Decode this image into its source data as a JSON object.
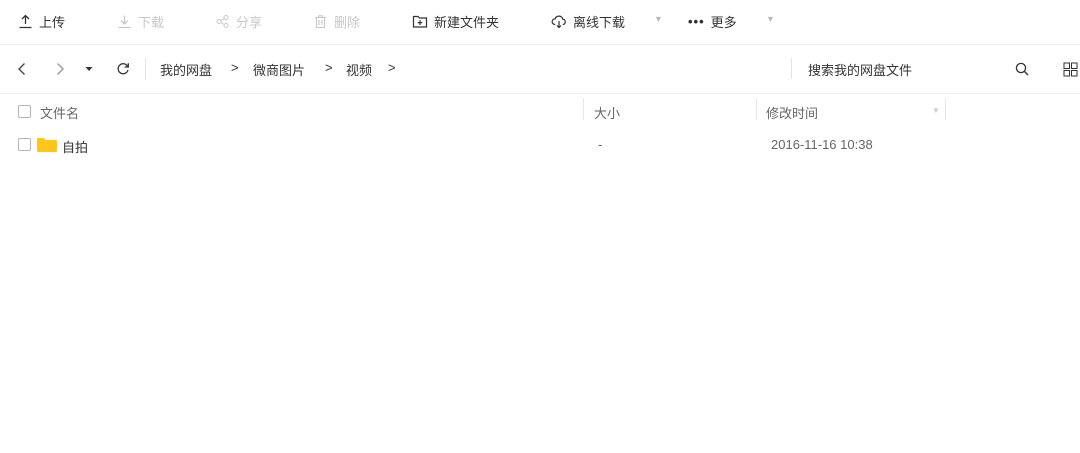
{
  "toolbar": {
    "upload": "上传",
    "download": "下载",
    "share": "分享",
    "delete": "删除",
    "new_folder": "新建文件夹",
    "offline_download": "离线下载",
    "more": "更多"
  },
  "nav": {
    "breadcrumb": [
      "我的网盘",
      "微商图片",
      "视频"
    ],
    "separator": ">",
    "search_placeholder": "搜索我的网盘文件"
  },
  "columns": {
    "name": "文件名",
    "size": "大小",
    "modified": "修改时间"
  },
  "files": [
    {
      "name": "自拍",
      "type": "folder",
      "size": "-",
      "modified": "2016-11-16 10:38"
    }
  ],
  "colors": {
    "folder": "#ffc61a",
    "disabled_text": "#c8c8c8",
    "divider": "#f0f0f0"
  },
  "icons": [
    "upload-icon",
    "download-icon",
    "share-icon",
    "delete-icon",
    "new-folder-icon",
    "cloud-download-icon",
    "more-dots-icon",
    "back-icon",
    "forward-icon",
    "history-dropdown-icon",
    "refresh-icon",
    "search-icon",
    "grid-view-icon",
    "folder-icon"
  ]
}
